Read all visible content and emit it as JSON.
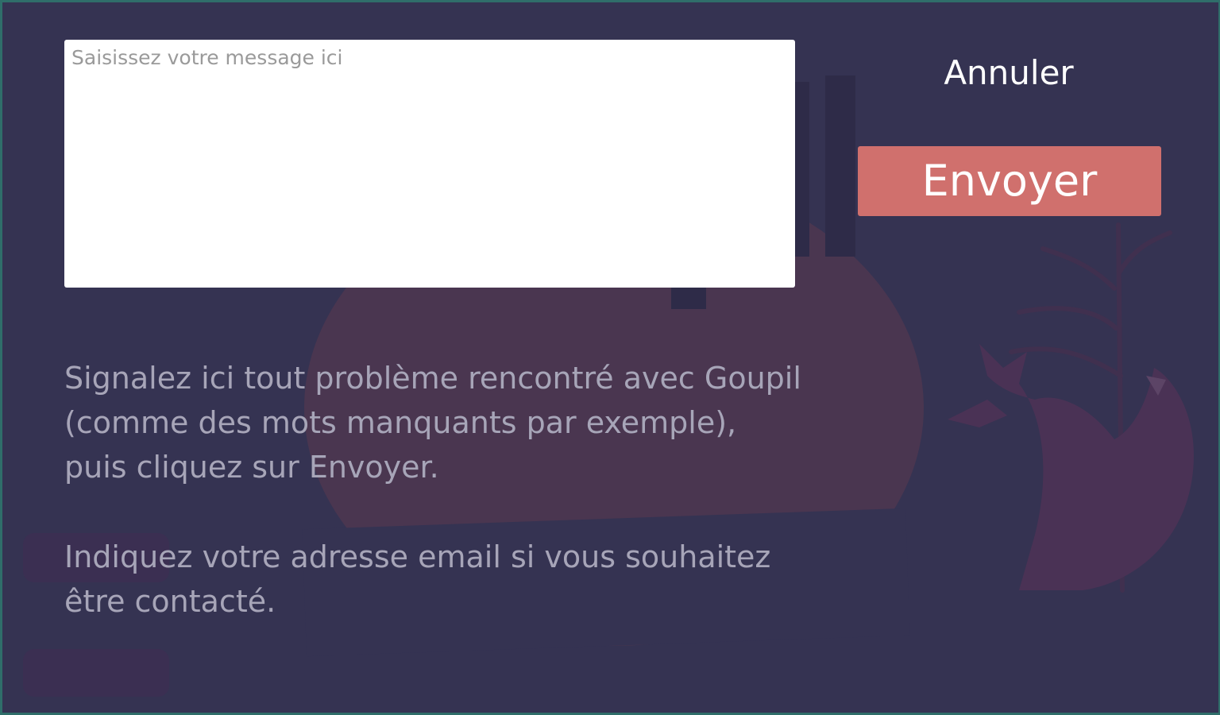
{
  "feedback_form": {
    "message_placeholder": "Saisissez votre message ici",
    "message_value": "",
    "cancel_label": "Annuler",
    "send_label": "Envoyer",
    "instructions": "Signalez ici tout problème rencontré avec Goupil (comme des mots manquants par exemple), puis cliquez sur Envoyer.",
    "email_hint": "Indiquez votre adresse email si vous souhaitez être contacté."
  },
  "colors": {
    "background": "#353352",
    "send_button": "#d0706d",
    "help_text": "#a7a5b8",
    "frame_border": "#2f6e6a"
  },
  "icons": [
    "fox-illustration"
  ]
}
